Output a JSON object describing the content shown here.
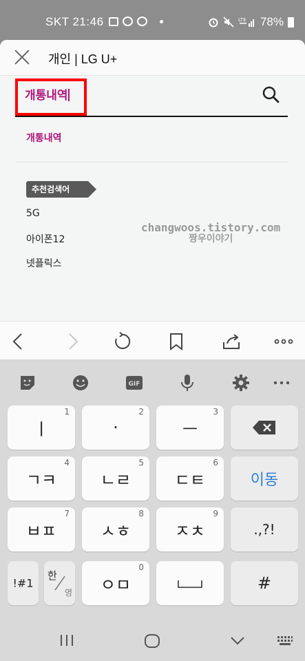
{
  "status_bar": {
    "carrier_time": "SKT 21:46",
    "battery": "78%",
    "icons": [
      "image-icon",
      "chat-icon",
      "talk-icon",
      "alarm-icon",
      "mute-icon",
      "lte-signal-icon",
      "battery-icon"
    ]
  },
  "titlebar": {
    "title": "개인 | LG U+"
  },
  "search": {
    "value": "개통내역",
    "suggestion": "개통내역"
  },
  "recommended": {
    "badge": "추천검색어",
    "items": [
      "5G",
      "아이폰12",
      "넷플릭스"
    ]
  },
  "watermark": {
    "line1": "changwoos.tistory.com",
    "line2": "짱우이야기"
  },
  "keyboard": {
    "keys": [
      {
        "label": "ㅣ",
        "num": "1"
      },
      {
        "label": "·",
        "num": "2"
      },
      {
        "label": "ㅡ",
        "num": "3"
      },
      {
        "label": "ㄱㅋ",
        "num": "4"
      },
      {
        "label": "ㄴㄹ",
        "num": "5"
      },
      {
        "label": "ㄷㅌ",
        "num": "6"
      },
      {
        "label": "이동",
        "num": ""
      },
      {
        "label": "ㅂㅍ",
        "num": "7"
      },
      {
        "label": "ㅅㅎ",
        "num": "8"
      },
      {
        "label": "ㅈㅊ",
        "num": "9"
      },
      {
        "label": ".,?!",
        "num": ""
      },
      {
        "label": "!#1",
        "num": ""
      },
      {
        "label": "한",
        "num": ""
      },
      {
        "label": "영",
        "num": ""
      },
      {
        "label": "ㅇㅁ",
        "num": "0"
      },
      {
        "label": "#",
        "num": ""
      }
    ]
  },
  "colors": {
    "accent": "#b0147b",
    "highlight": "#ff0000",
    "go_key": "#2d7fd6"
  }
}
